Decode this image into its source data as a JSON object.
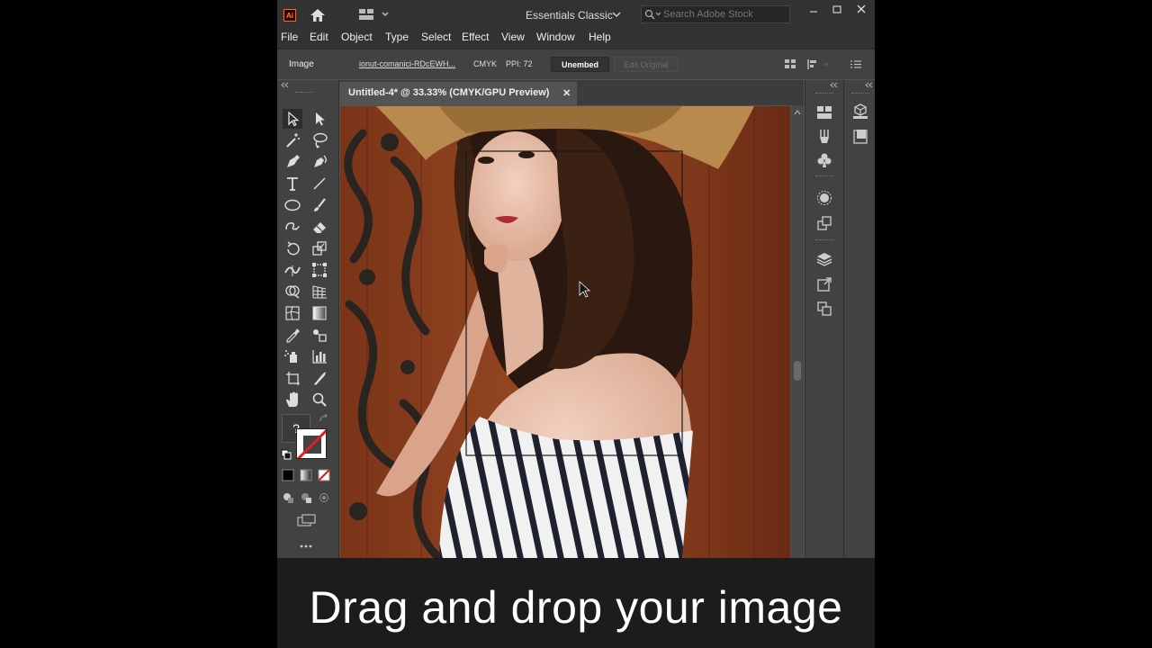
{
  "window": {
    "app_logo": "Ai",
    "workspace": "Essentials Classic",
    "search_placeholder": "Search Adobe Stock",
    "accent_color": "#ff6a00"
  },
  "menu": [
    "File",
    "Edit",
    "Object",
    "Type",
    "Select",
    "Effect",
    "View",
    "Window",
    "Help"
  ],
  "control_bar": {
    "type_label": "Image",
    "filename": "ionut-comanici-RDcEWH...",
    "color_mode": "CMYK",
    "ppi": "PPI: 72",
    "unembed": "Unembed",
    "edit_original": "Edit Original"
  },
  "document": {
    "tab_title": "Untitled-4* @ 33.33% (CMYK/GPU Preview)",
    "close_glyph": "✕"
  },
  "toolbar": {
    "unknown_fill": "?"
  },
  "caption": "Drag and drop your image"
}
